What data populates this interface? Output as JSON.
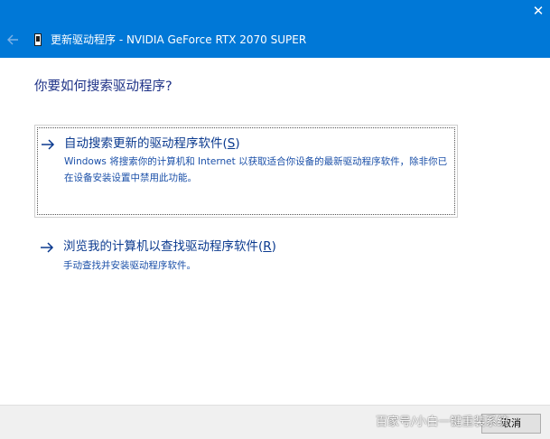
{
  "window": {
    "title": "更新驱动程序 - NVIDIA GeForce RTX 2070 SUPER",
    "close_glyph": "✕",
    "back_icon": "back-arrow-icon",
    "device_icon": "device-icon"
  },
  "main": {
    "heading": "你要如何搜索驱动程序?",
    "options": [
      {
        "icon": "arrow-right-icon",
        "title_prefix": "自动搜索更新的驱动程序软件(",
        "title_accel": "S",
        "title_suffix": ")",
        "description": "Windows 将搜索你的计算机和 Internet 以获取适合你设备的最新驱动程序软件，除非你已在设备安装设置中禁用此功能。",
        "focused": true
      },
      {
        "icon": "arrow-right-icon",
        "title_prefix": "浏览我的计算机以查找驱动程序软件(",
        "title_accel": "R",
        "title_suffix": ")",
        "description": "手动查找并安装驱动程序软件。",
        "focused": false
      }
    ]
  },
  "footer": {
    "cancel_label": "取消",
    "watermark": "百家号/小白一键重装系统"
  },
  "colors": {
    "titlebar": "#0078d7",
    "heading": "#1e3287",
    "link": "#0b3a8f",
    "description": "#1a4fa8",
    "footer": "#f0f0f0"
  }
}
